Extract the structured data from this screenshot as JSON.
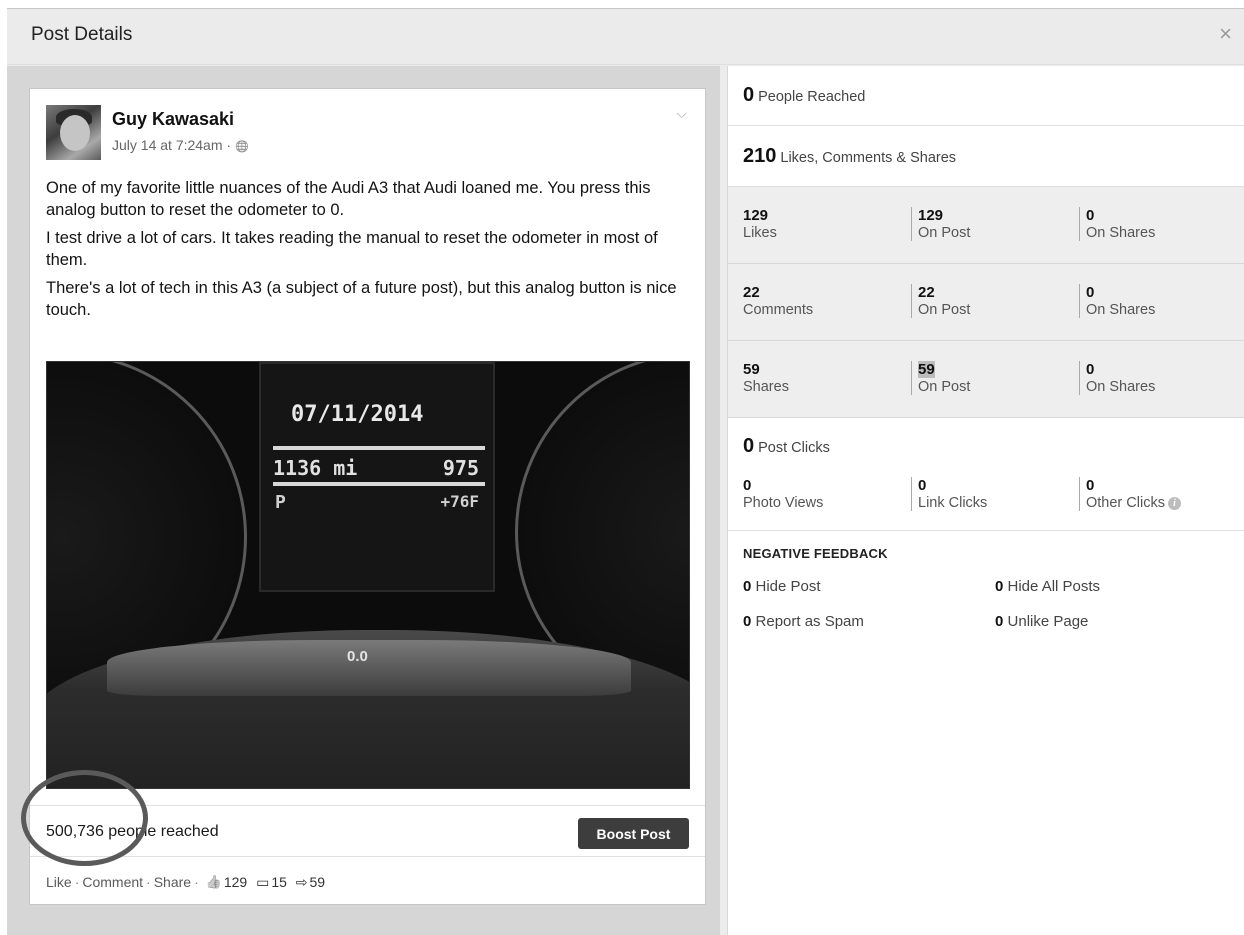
{
  "modal": {
    "title": "Post Details",
    "close_label": "×"
  },
  "post": {
    "author": "Guy Kawasaki",
    "date": "July 14 at 7:24am · ",
    "globe_icon": "🌐",
    "menu_chevron": "⌵",
    "paragraphs": [
      "One of my favorite little nuances of the Audi A3 that Audi loaned me. You press this analog button to reset the odometer to 0.",
      "I test drive a lot of cars. It takes reading the manual to reset the odometer in most of them.",
      "There's a lot of tech in this A3 (a subject of a future post), but this analog button is nice touch."
    ],
    "photo": {
      "screen_date": "07/11/2014",
      "odometer": "1136  mi",
      "trip": "975",
      "gear": "P",
      "temp": "+76F",
      "panel_value": "0.0"
    },
    "reach_text": "500,736 people reached",
    "boost_label": "Boost Post",
    "actions": {
      "like": "Like",
      "comment": "Comment",
      "share": "Share",
      "sep": "·",
      "likes_count": "129",
      "comments_count": "15",
      "shares_count": "59",
      "like_icon": "👍",
      "comment_icon": "▭",
      "share_icon": "⇨"
    }
  },
  "stats": {
    "people_reached": {
      "value": "0",
      "label": "People Reached"
    },
    "engagement": {
      "value": "210",
      "label": "Likes, Comments & Shares"
    },
    "rows": [
      {
        "total": "129",
        "total_label": "Likes",
        "on_post": "129",
        "on_post_label": "On Post",
        "on_shares": "0",
        "on_shares_label": "On Shares"
      },
      {
        "total": "22",
        "total_label": "Comments",
        "on_post": "22",
        "on_post_label": "On Post",
        "on_shares": "0",
        "on_shares_label": "On Shares"
      },
      {
        "total": "59",
        "total_label": "Shares",
        "on_post": "59",
        "on_post_label": "On Post",
        "on_shares": "0",
        "on_shares_label": "On Shares"
      }
    ],
    "post_clicks": {
      "value": "0",
      "label": "Post Clicks"
    },
    "clicks": [
      {
        "value": "0",
        "label": "Photo Views"
      },
      {
        "value": "0",
        "label": "Link Clicks"
      },
      {
        "value": "0",
        "label": "Other Clicks"
      }
    ],
    "info_icon": "i",
    "negative_feedback": {
      "title": "NEGATIVE FEEDBACK",
      "items": [
        {
          "value": "0",
          "label": "Hide Post"
        },
        {
          "value": "0",
          "label": "Hide All Posts"
        },
        {
          "value": "0",
          "label": "Report as Spam"
        },
        {
          "value": "0",
          "label": "Unlike Page"
        }
      ]
    }
  }
}
